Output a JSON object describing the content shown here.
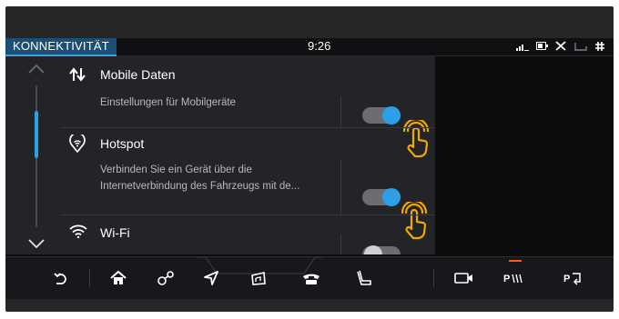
{
  "status_bar": {
    "app_title": "KONNEKTIVITÄT",
    "time": "9:26",
    "icons": [
      "signal-icon",
      "battery-icon",
      "mute-icon",
      "seat-icon",
      "hash-icon"
    ]
  },
  "settings": {
    "items": [
      {
        "title": "Mobile Daten",
        "subtitle_lines": [
          "Einstellungen für Mobilgeräte"
        ],
        "icon": "mobile-data-icon",
        "toggle_on": true
      },
      {
        "title": "Hotspot",
        "subtitle_lines": [
          "Verbinden Sie ein Gerät über die",
          "Internetverbindung des Fahrzeugs mit de..."
        ],
        "icon": "hotspot-icon",
        "toggle_on": true
      },
      {
        "title": "Wi-Fi",
        "subtitle_lines": [],
        "icon": "wifi-icon",
        "toggle_on": false
      }
    ],
    "scroll_position": 0.15
  },
  "nav": {
    "items": [
      "back-icon",
      "home-icon",
      "connectivity-icon",
      "navigation-icon",
      "media-icon",
      "phone-icon",
      "seat-climate-icon",
      "camera-icon",
      "park-assist-icon",
      "park-exit-icon"
    ],
    "park_assist_label": "P",
    "park_exit_label": "P"
  },
  "colors": {
    "accent": "#2e9ee6",
    "title_bar": "#1c4f76",
    "hand_icon": "#f0a800",
    "nav_indicator": "#ff5a1e"
  }
}
